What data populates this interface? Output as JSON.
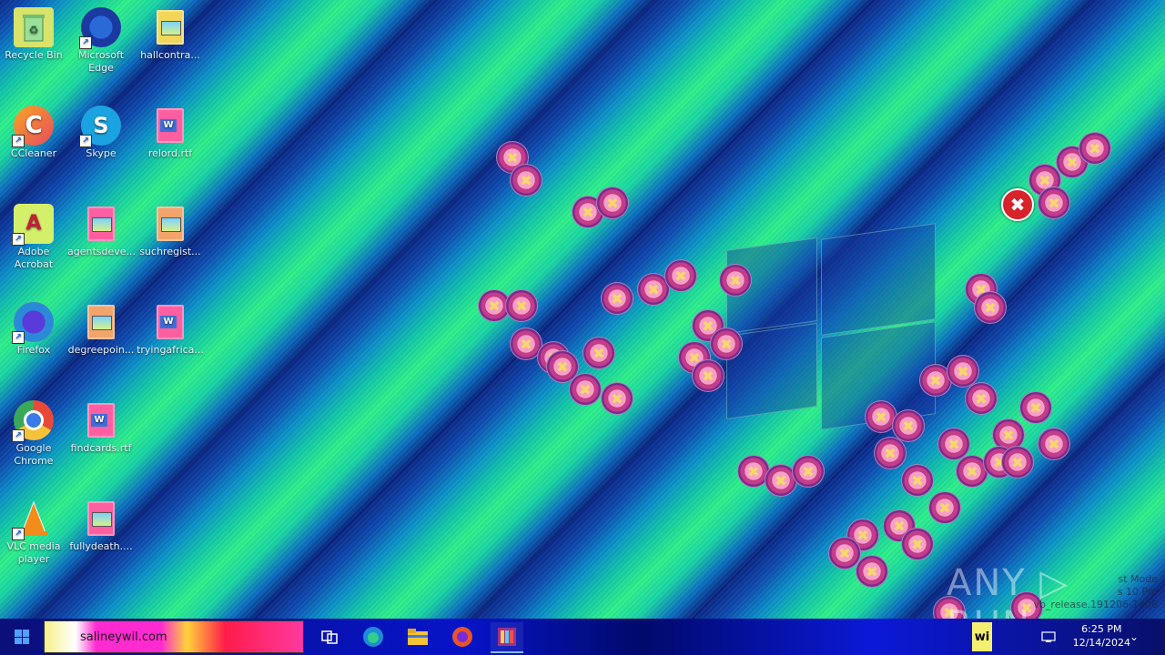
{
  "desktop": {
    "icons": [
      {
        "label": "Recycle Bin",
        "icon": "recycle-bin-icon"
      },
      {
        "label": "Microsoft Edge",
        "icon": "edge-icon"
      },
      {
        "label": "hallcontra...",
        "icon": "image-file-icon"
      },
      {
        "label": "CCleaner",
        "icon": "ccleaner-icon"
      },
      {
        "label": "Skype",
        "icon": "skype-icon"
      },
      {
        "label": "relord.rtf",
        "icon": "word-file-icon"
      },
      {
        "label": "Adobe Acrobat",
        "icon": "acrobat-icon"
      },
      {
        "label": "agentsdeve...",
        "icon": "image-file-icon"
      },
      {
        "label": "suchregist...",
        "icon": "image-file-icon"
      },
      {
        "label": "Firefox",
        "icon": "firefox-icon"
      },
      {
        "label": "degreepoin...",
        "icon": "image-file-icon"
      },
      {
        "label": "tryingafrica...",
        "icon": "word-file-icon"
      },
      {
        "label": "Google Chrome",
        "icon": "chrome-icon"
      },
      {
        "label": "findcards.rtf",
        "icon": "word-file-icon"
      },
      {
        "label": "VLC media player",
        "icon": "vlc-icon"
      },
      {
        "label": "fullydeath....",
        "icon": "image-file-icon"
      }
    ]
  },
  "error_glyph": "✖",
  "watermark": {
    "text": "ANY ▷ RUN"
  },
  "test_mode": {
    "line1": "st Mode",
    "line2": "s 10 Pro",
    "line3": "vb_release.191206-1406"
  },
  "taskbar": {
    "search_text": "salineywil.com",
    "tray_box": "wi",
    "clock_time": "6:25 PM",
    "clock_date": "12/14/2024"
  },
  "colors": {
    "taskbar": "#0614c8",
    "error_red": "#d8232a"
  }
}
